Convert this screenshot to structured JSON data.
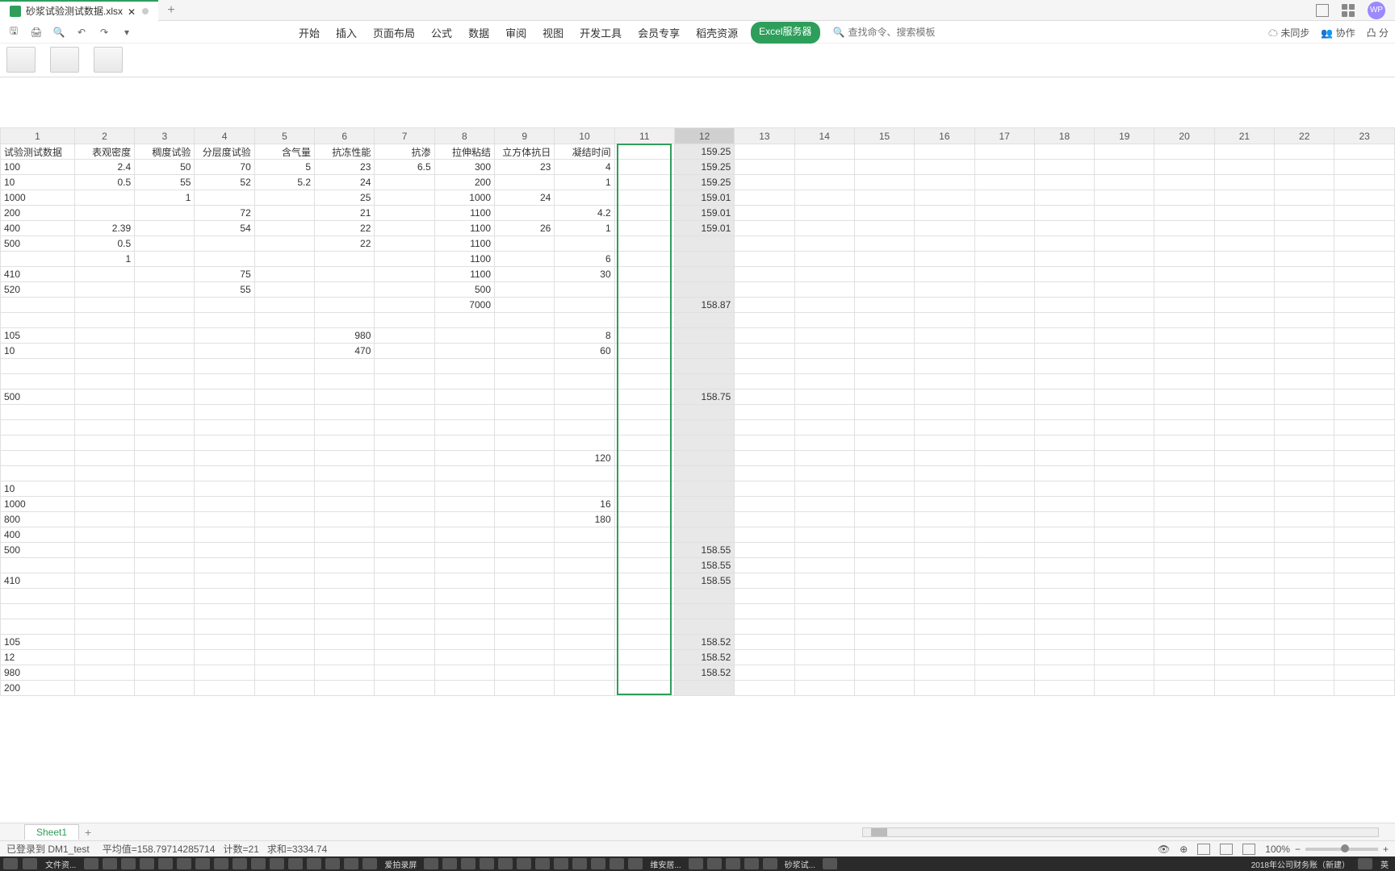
{
  "title": {
    "filename": "砂浆试验测试数据.xlsx",
    "avatar": "WP"
  },
  "menu": {
    "items": [
      "开始",
      "插入",
      "页面布局",
      "公式",
      "数据",
      "审阅",
      "视图",
      "开发工具",
      "会员专享",
      "稻壳资源"
    ],
    "pill": "Excel服务器",
    "search_placeholder": "查找命令、搜索模板"
  },
  "right_actions": {
    "sync": "未同步",
    "collab": "协作",
    "share": "分"
  },
  "grid": {
    "col_headers": [
      "1",
      "2",
      "3",
      "4",
      "5",
      "6",
      "7",
      "8",
      "9",
      "10",
      "11",
      "12",
      "13",
      "14",
      "15",
      "16",
      "17",
      "18",
      "19",
      "20",
      "21",
      "22",
      "23"
    ],
    "row1": [
      "试验测试数据",
      "表观密度",
      "稠度试验",
      "分层度试验",
      "含气量",
      "抗冻性能",
      "抗渗",
      "拉伸粘结",
      "立方体抗日",
      "凝结时间",
      "",
      "",
      "",
      "",
      "",
      "",
      "",
      "",
      "",
      "",
      "",
      "",
      ""
    ],
    "data": [
      [
        "100",
        "2.4",
        "50",
        "70",
        "5",
        "23",
        "6.5",
        "300",
        "23",
        "4",
        "",
        "159.25"
      ],
      [
        "10",
        "0.5",
        "55",
        "52",
        "5.2",
        "24",
        "",
        "200",
        "",
        "1",
        "",
        "159.25"
      ],
      [
        "1000",
        "",
        "1",
        "",
        "",
        "25",
        "",
        "1000",
        "24",
        "",
        "",
        "159.01"
      ],
      [
        "200",
        "",
        "",
        "72",
        "",
        "21",
        "",
        "1100",
        "",
        "4.2",
        "",
        "159.01"
      ],
      [
        "400",
        "2.39",
        "",
        "54",
        "",
        "22",
        "",
        "1100",
        "26",
        "1",
        "",
        "159.01"
      ],
      [
        "500",
        "0.5",
        "",
        "",
        "",
        "22",
        "",
        "1100",
        "",
        "",
        "",
        ""
      ],
      [
        "",
        "1",
        "",
        "",
        "",
        "",
        "",
        "1100",
        "",
        "6",
        "",
        ""
      ],
      [
        "410",
        "",
        "",
        "75",
        "",
        "",
        "",
        "1100",
        "",
        "30",
        "",
        ""
      ],
      [
        "520",
        "",
        "",
        "55",
        "",
        "",
        "",
        "500",
        "",
        "",
        "",
        ""
      ],
      [
        "",
        "",
        "",
        "",
        "",
        "",
        "",
        "7000",
        "",
        "",
        "",
        "158.87"
      ],
      [
        "",
        "",
        "",
        "",
        "",
        "",
        "",
        "",
        "",
        "",
        "",
        ""
      ],
      [
        "105",
        "",
        "",
        "",
        "",
        "980",
        "",
        "",
        "",
        "8",
        "",
        ""
      ],
      [
        "10",
        "",
        "",
        "",
        "",
        "470",
        "",
        "",
        "",
        "60",
        "",
        ""
      ],
      [
        "",
        "",
        "",
        "",
        "",
        "",
        "",
        "",
        "",
        "",
        "",
        ""
      ],
      [
        "",
        "",
        "",
        "",
        "",
        "",
        "",
        "",
        "",
        "",
        "",
        ""
      ],
      [
        "500",
        "",
        "",
        "",
        "",
        "",
        "",
        "",
        "",
        "",
        "",
        "158.75"
      ],
      [
        "",
        "",
        "",
        "",
        "",
        "",
        "",
        "",
        "",
        "",
        "",
        ""
      ],
      [
        "",
        "",
        "",
        "",
        "",
        "",
        "",
        "",
        "",
        "",
        "",
        ""
      ],
      [
        "",
        "",
        "",
        "",
        "",
        "",
        "",
        "",
        "",
        "",
        "",
        ""
      ],
      [
        "",
        "",
        "",
        "",
        "",
        "",
        "",
        "",
        "",
        "120",
        "",
        ""
      ],
      [
        "",
        "",
        "",
        "",
        "",
        "",
        "",
        "",
        "",
        "",
        "",
        ""
      ],
      [
        "10",
        "",
        "",
        "",
        "",
        "",
        "",
        "",
        "",
        "",
        "",
        ""
      ],
      [
        "1000",
        "",
        "",
        "",
        "",
        "",
        "",
        "",
        "",
        "16",
        "",
        ""
      ],
      [
        "800",
        "",
        "",
        "",
        "",
        "",
        "",
        "",
        "",
        "180",
        "",
        ""
      ],
      [
        "400",
        "",
        "",
        "",
        "",
        "",
        "",
        "",
        "",
        "",
        "",
        ""
      ],
      [
        "500",
        "",
        "",
        "",
        "",
        "",
        "",
        "",
        "",
        "",
        "",
        "158.55"
      ],
      [
        "",
        "",
        "",
        "",
        "",
        "",
        "",
        "",
        "",
        "",
        "",
        "158.55"
      ],
      [
        "410",
        "",
        "",
        "",
        "",
        "",
        "",
        "",
        "",
        "",
        "",
        "158.55"
      ],
      [
        "",
        "",
        "",
        "",
        "",
        "",
        "",
        "",
        "",
        "",
        "",
        ""
      ],
      [
        "",
        "",
        "",
        "",
        "",
        "",
        "",
        "",
        "",
        "",
        "",
        ""
      ],
      [
        "",
        "",
        "",
        "",
        "",
        "",
        "",
        "",
        "",
        "",
        "",
        ""
      ],
      [
        "105",
        "",
        "",
        "",
        "",
        "",
        "",
        "",
        "",
        "",
        "",
        "158.52"
      ],
      [
        "12",
        "",
        "",
        "",
        "",
        "",
        "",
        "",
        "",
        "",
        "",
        "158.52"
      ],
      [
        "980",
        "",
        "",
        "",
        "",
        "",
        "",
        "",
        "",
        "",
        "",
        "158.52"
      ],
      [
        "200",
        "",
        "",
        "",
        "",
        "",
        "",
        "",
        "",
        "",
        "",
        ""
      ]
    ],
    "first_col12": "159.25",
    "selected_col_index": 11
  },
  "sheet": {
    "name": "Sheet1"
  },
  "status": {
    "login": "已登录到 DM1_test",
    "avg_label": "平均值=",
    "avg": "158.79714285714",
    "count_label": "计数=",
    "count": "21",
    "sum_label": "求和=",
    "sum": "3334.74",
    "zoom": "100%"
  },
  "taskbar": {
    "items": [
      "文件资...",
      "",
      "",
      "",
      "",
      "",
      "",
      "",
      "",
      "",
      "",
      "",
      "",
      "",
      "",
      "",
      "爱拍录屏",
      "",
      "",
      "",
      "",
      "",
      "",
      "",
      "",
      "",
      "",
      "",
      "维安居...",
      "",
      "",
      "",
      "",
      "砂浆试..."
    ],
    "right": "2018年公司财务账（新建）",
    "lang": "英"
  }
}
